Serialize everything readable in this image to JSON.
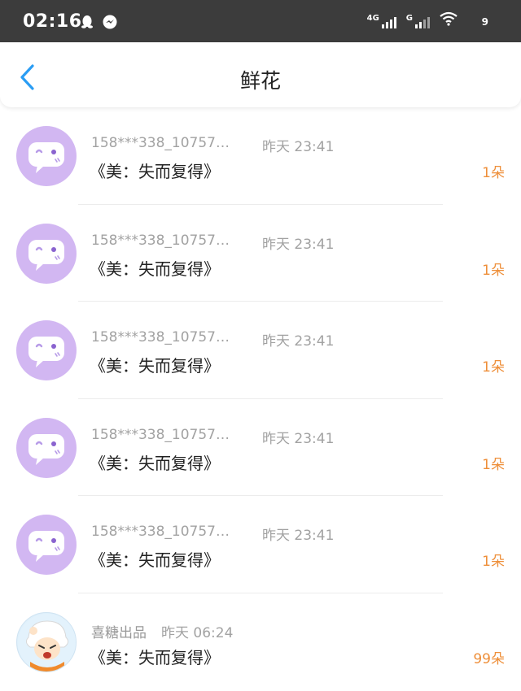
{
  "status_bar": {
    "time": "02:16",
    "left_icons": [
      "qq-icon",
      "messenger-icon"
    ],
    "network_1": "4G",
    "network_2": "G",
    "battery": "9"
  },
  "header": {
    "title": "鲜花",
    "back_icon": "chevron-left-icon"
  },
  "records": [
    {
      "name": "158***338_10757…",
      "time": "昨天 23:41",
      "gift": "《美：失而复得》",
      "count": "1朵",
      "avatar": "chat-bubble-face"
    },
    {
      "name": "158***338_10757…",
      "time": "昨天 23:41",
      "gift": "《美：失而复得》",
      "count": "1朵",
      "avatar": "chat-bubble-face"
    },
    {
      "name": "158***338_10757…",
      "time": "昨天 23:41",
      "gift": "《美：失而复得》",
      "count": "1朵",
      "avatar": "chat-bubble-face"
    },
    {
      "name": "158***338_10757…",
      "time": "昨天 23:41",
      "gift": "《美：失而复得》",
      "count": "1朵",
      "avatar": "chat-bubble-face"
    },
    {
      "name": "158***338_10757…",
      "time": "昨天 23:41",
      "gift": "《美：失而复得》",
      "count": "1朵",
      "avatar": "chat-bubble-face"
    },
    {
      "name": "喜糖出品",
      "time": "昨天 06:24",
      "gift": "《美：失而复得》",
      "count": "99朵",
      "avatar": "cartoon-character"
    }
  ],
  "colors": {
    "status_bar_bg": "#3c3c3c",
    "accent_blue": "#2a9df4",
    "count_orange": "#ee8f3a",
    "avatar_purple": "#d2b7f2"
  }
}
